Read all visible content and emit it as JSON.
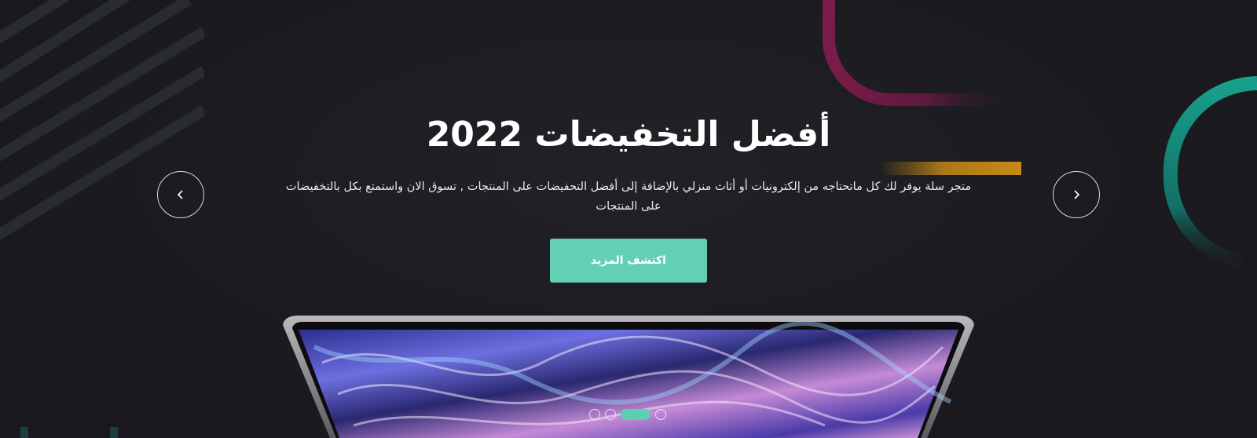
{
  "hero": {
    "title": "أفضل التخفيضات 2022",
    "description": "متجر سلة يوفر لك كل ماتحتاجه من إلكترونيات أو أثاث منزلي بالإضافة إلى أفضل التحفيضات على المنتجات , تسوق الان واستمتع بكل بالتخفيضات على المنتجات",
    "cta_label": "اكتشف المزيد",
    "prev_icon": "chevron-left-icon",
    "next_icon": "chevron-right-icon",
    "slides_total": 4,
    "active_slide": 3
  },
  "colors": {
    "background": "#1c1b20",
    "accent": "#63d0b5",
    "arc_magenta": "#8a1f52",
    "arc_teal": "#169c8a",
    "bar_gold": "#c58a17"
  }
}
